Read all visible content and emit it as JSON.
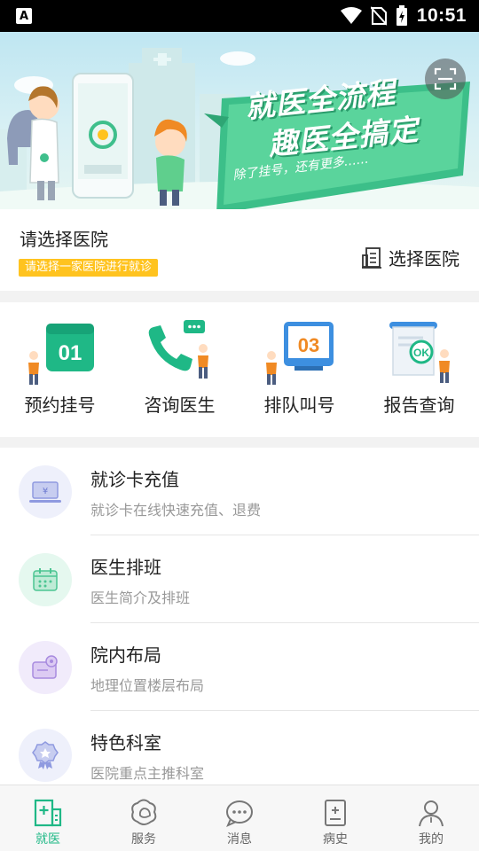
{
  "status_bar": {
    "time": "10:51",
    "app_letter": "A"
  },
  "banner": {
    "headline_line1": "就医全流程",
    "headline_line2": "趣医全搞定",
    "tagline": "除了挂号，还有更多……"
  },
  "hospital": {
    "title": "请选择医院",
    "tag": "请选择一家医院进行就诊",
    "select_label": "选择医院"
  },
  "quick_actions": [
    {
      "label": "预约挂号",
      "badge": "01"
    },
    {
      "label": "咨询医生"
    },
    {
      "label": "排队叫号",
      "badge": "03"
    },
    {
      "label": "报告查询",
      "badge": "OK"
    }
  ],
  "services": [
    {
      "title": "就诊卡充值",
      "subtitle": "就诊卡在线快速充值、退费"
    },
    {
      "title": "医生排班",
      "subtitle": "医生简介及排班"
    },
    {
      "title": "院内布局",
      "subtitle": "地理位置楼层布局"
    },
    {
      "title": "特色科室",
      "subtitle": "医院重点主推科室"
    }
  ],
  "bottom_nav": [
    {
      "label": "就医",
      "active": true
    },
    {
      "label": "服务"
    },
    {
      "label": "消息"
    },
    {
      "label": "病史"
    },
    {
      "label": "我的"
    }
  ],
  "colors": {
    "accent": "#1fb886",
    "tag_yellow": "#ffc31f",
    "orange": "#f08a24"
  }
}
